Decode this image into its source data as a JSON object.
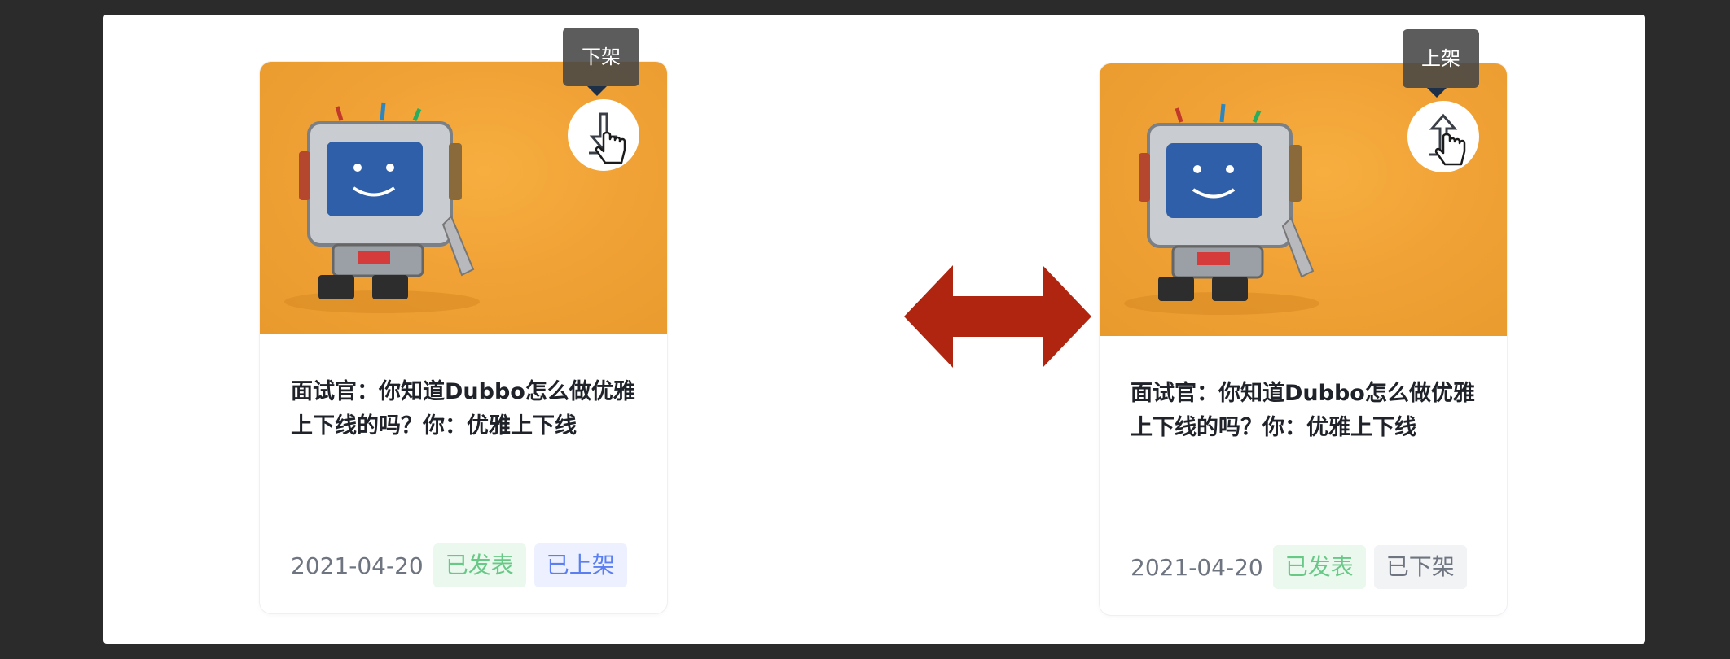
{
  "cards": [
    {
      "tooltip": "下架",
      "action_icon": "download-arrow-icon",
      "title": "面试官：你知道Dubbo怎么做优雅上下线的吗？你：优雅上下线",
      "date": "2021-04-20",
      "tags": [
        "已发表",
        "已上架"
      ]
    },
    {
      "tooltip": "上架",
      "action_icon": "upload-arrow-icon",
      "title": "面试官：你知道Dubbo怎么做优雅上下线的吗？你：优雅上下线",
      "date": "2021-04-20",
      "tags": [
        "已发表",
        "已下架"
      ]
    }
  ],
  "colors": {
    "cover_orange": "#f1a236",
    "swap_arrow": "#b0250f",
    "tag_published_text": "#68c987",
    "tag_listed_text": "#5b7ff0",
    "tag_unlisted_text": "#6e7580"
  },
  "icons": [
    "robot-illustration",
    "hand-cursor-icon",
    "double-arrow-icon"
  ]
}
